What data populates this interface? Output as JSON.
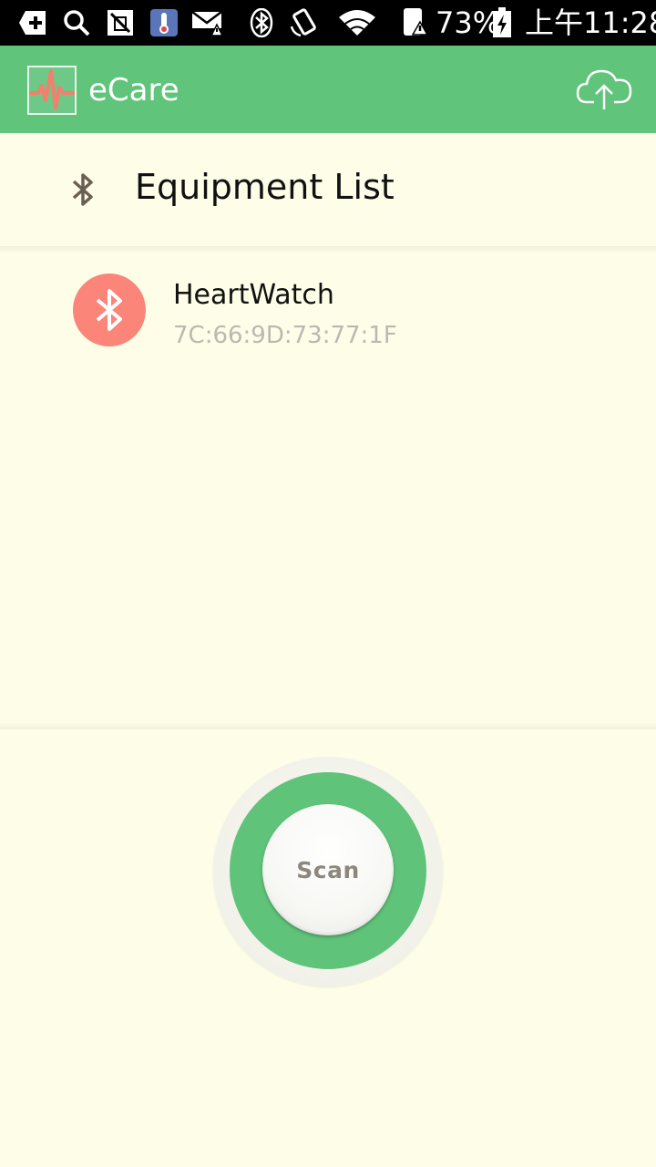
{
  "status_bar": {
    "battery_percent": "73%",
    "time": "上午11:28",
    "icons": [
      "add-box-icon",
      "search-icon",
      "no-sim-icon",
      "thermometer-app-icon",
      "mail-alert-icon",
      "bluetooth-icon",
      "rotate-icon",
      "wifi-icon",
      "phone-alert-icon",
      "battery-charging-icon"
    ]
  },
  "app_bar": {
    "title": "eCare",
    "logo_icon": "heartbeat-logo-icon",
    "upload_icon": "cloud-upload-icon",
    "background": "#61c47b"
  },
  "equipment": {
    "header_title": "Equipment List",
    "header_icon": "bluetooth-icon",
    "devices": [
      {
        "name": "HeartWatch",
        "mac": "7C:66:9D:73:77:1F",
        "icon": "bluetooth-icon",
        "icon_bg": "#fa8578"
      }
    ]
  },
  "scan": {
    "label": "Scan",
    "ring_color": "#60c37a"
  }
}
